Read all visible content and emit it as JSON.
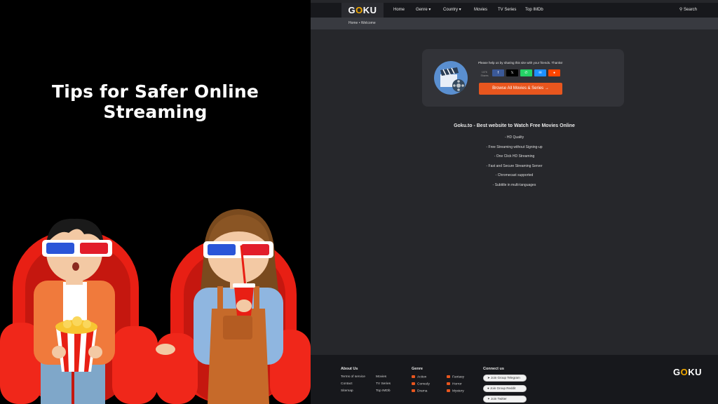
{
  "banner": {
    "title": "Tips for Safer Online Streaming"
  },
  "site": {
    "logo": {
      "prefix": "G",
      "o": "O",
      "suffix": "KU"
    },
    "nav": [
      {
        "label": "Home"
      },
      {
        "label": "Genre ▾"
      },
      {
        "label": "Country ▾"
      },
      {
        "label": "Movies"
      },
      {
        "label": "TV Series"
      },
      {
        "label": "Top IMDb"
      }
    ],
    "search_label": "Search",
    "breadcrumb": {
      "home": "Home",
      "current": "Welcome"
    },
    "share": {
      "text": "Please help us by sharing this site with your friends. Thanks!",
      "count": "107K",
      "count_label": "Shares",
      "buttons": [
        {
          "icon": "f",
          "color": "#3b5998"
        },
        {
          "icon": "𝕏",
          "color": "#000000"
        },
        {
          "icon": "✆",
          "color": "#25d366"
        },
        {
          "icon": "✉",
          "color": "#1e90ff"
        },
        {
          "icon": "●",
          "color": "#ff4500"
        }
      ],
      "browse_label": "Browse All Movies & Series →"
    },
    "features": {
      "title": "Goku.to - Best website to Watch Free Movies Online",
      "items": [
        "- HD Quality",
        "- Free Streaming without Signing-up",
        "- One Click HD Streaming",
        "- Fast and Secure Streaming Server",
        "- Chromecast supported",
        "- Subtitle in multi-languages"
      ]
    },
    "footer": {
      "about_title": "About Us",
      "about_links": [
        "Terms of service",
        "Contact",
        "Sitemap"
      ],
      "about_links2": [
        "Movies",
        "TV Series",
        "Top IMDb"
      ],
      "genre_title": "Genre",
      "genre_links": [
        "Action",
        "Comedy",
        "Drama"
      ],
      "genre_links2": [
        "Fantasy",
        "Horror",
        "Mystery"
      ],
      "connect_title": "Connect us",
      "connect_links": [
        "Join Group Telegram",
        "Join Group Reddit",
        "Join Twitter"
      ]
    },
    "colors": {
      "accent": "#e8561e",
      "logo_o": "#f2a900",
      "bg": "#26272b",
      "nav_bg": "#17181c"
    }
  }
}
